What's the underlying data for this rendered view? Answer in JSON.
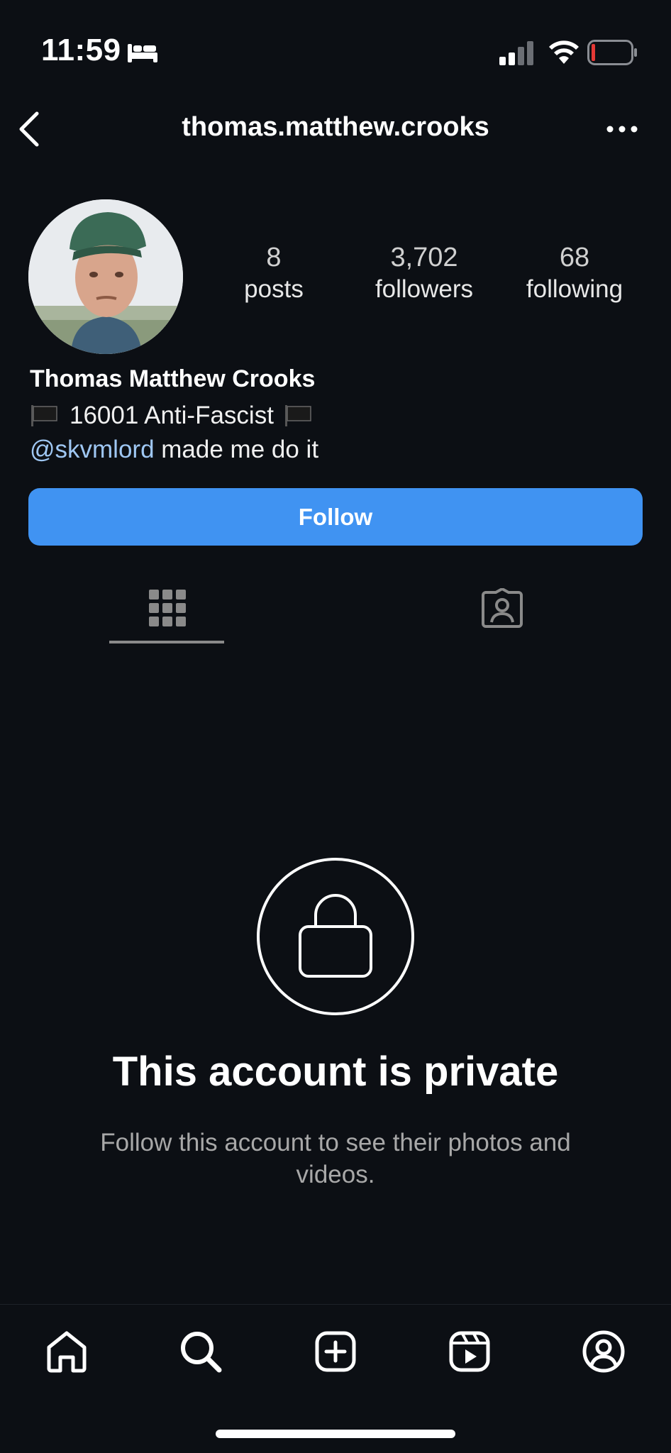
{
  "status_bar": {
    "time": "11:59"
  },
  "header": {
    "username": "thomas.matthew.crooks"
  },
  "profile": {
    "stats": [
      {
        "value": "8",
        "label": "posts"
      },
      {
        "value": "3,702",
        "label": "followers"
      },
      {
        "value": "68",
        "label": "following"
      }
    ],
    "full_name": "Thomas Matthew Crooks",
    "bio_line1": "16001 Anti-Fascist",
    "bio_mention": "@skvmlord",
    "bio_line2_rest": " made me do it",
    "follow_label": "Follow"
  },
  "private_notice": {
    "title": "This account is private",
    "description": "Follow this account to see their photos and videos."
  },
  "colors": {
    "background": "#0c0f14",
    "accent": "#4093f2",
    "mention": "#9fc7f3"
  },
  "icons": {
    "status": [
      "bed-icon",
      "signal-icon",
      "wifi-icon",
      "battery-icon"
    ],
    "nav": [
      "home-icon",
      "search-icon",
      "create-icon",
      "reels-icon",
      "profile-icon"
    ]
  }
}
